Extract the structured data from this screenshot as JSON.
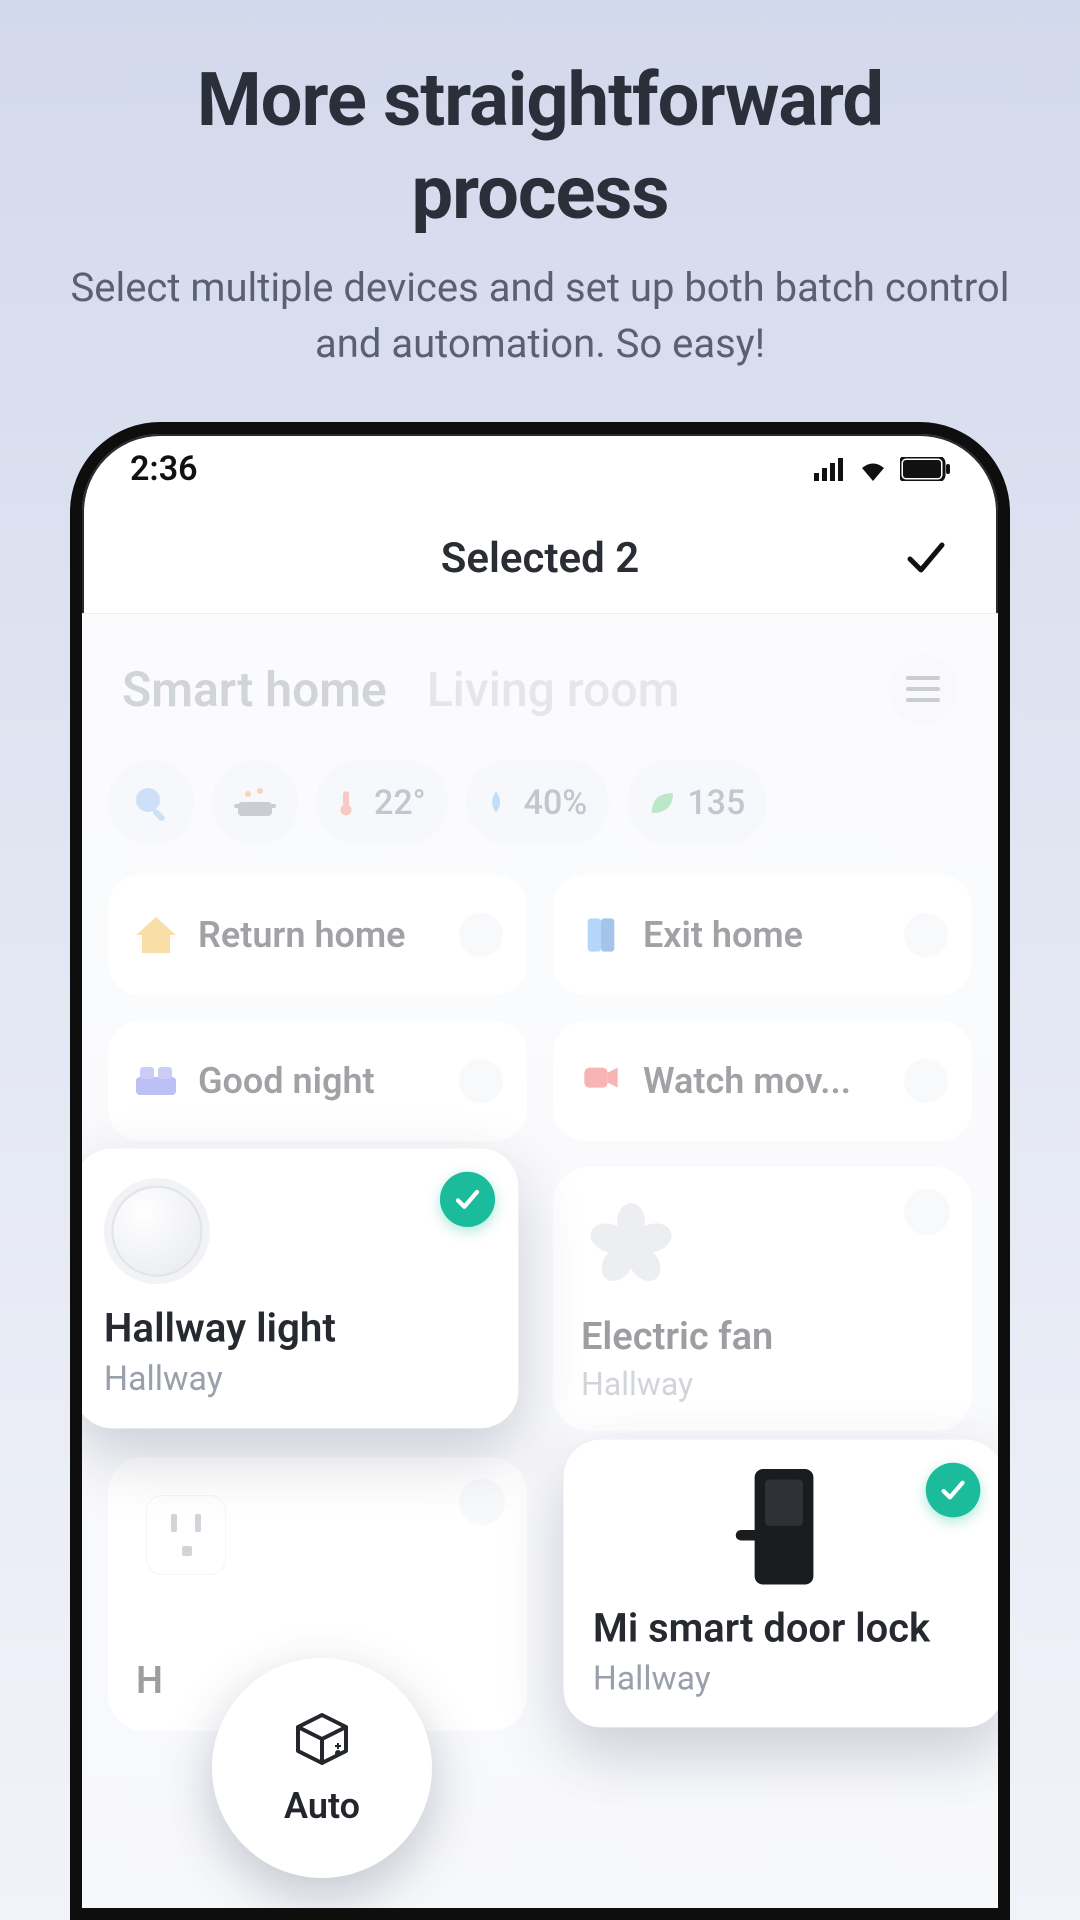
{
  "hero": {
    "title_line1": "More straightforward",
    "title_line2": "process",
    "subtitle": "Select multiple devices and set up both batch control and automation. So easy!"
  },
  "statusbar": {
    "time": "2:36"
  },
  "appbar": {
    "title": "Selected 2"
  },
  "tabs": {
    "active": "Smart home",
    "other": "Living room"
  },
  "chips": {
    "temp": "22°",
    "humidity": "40%",
    "air": "135"
  },
  "scenes": [
    {
      "label": "Return home"
    },
    {
      "label": "Exit home"
    },
    {
      "label": "Good night"
    },
    {
      "label": "Watch mov..."
    }
  ],
  "devices": [
    {
      "name": "Hallway light",
      "room": "Hallway",
      "selected": true
    },
    {
      "name": "Electric fan",
      "room": "Hallway",
      "selected": false
    },
    {
      "name": "H",
      "room": "",
      "selected": false
    },
    {
      "name": "Mi smart door lock",
      "room": "Hallway",
      "selected": true
    }
  ],
  "fab": {
    "label": "Auto"
  }
}
